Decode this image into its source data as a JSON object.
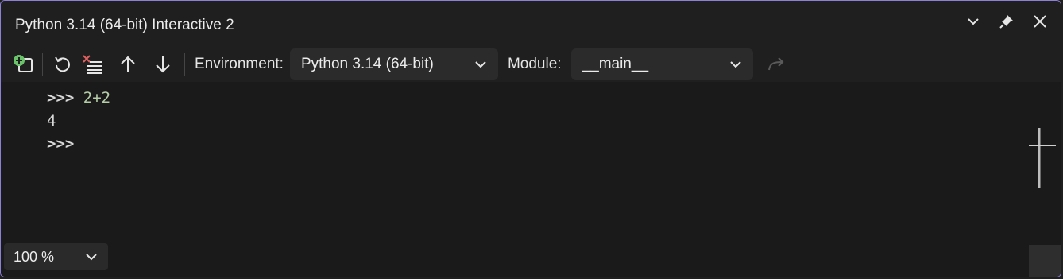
{
  "window": {
    "title": "Python 3.14 (64-bit) Interactive 2"
  },
  "toolbar": {
    "environment_label": "Environment:",
    "environment_value": "Python 3.14 (64-bit)",
    "module_label": "Module:",
    "module_value": "__main__"
  },
  "console": {
    "lines": [
      {
        "prompt": ">>>",
        "code": "2+2"
      },
      {
        "output": "4"
      },
      {
        "prompt": ">>>",
        "code": ""
      }
    ]
  },
  "zoom": {
    "value": "100 %"
  },
  "colors": {
    "window_border": "#8b7fd6",
    "add_icon_green": "#6ac36a",
    "clear_icon_red": "#e06060",
    "code_text": "#b5cea8"
  }
}
